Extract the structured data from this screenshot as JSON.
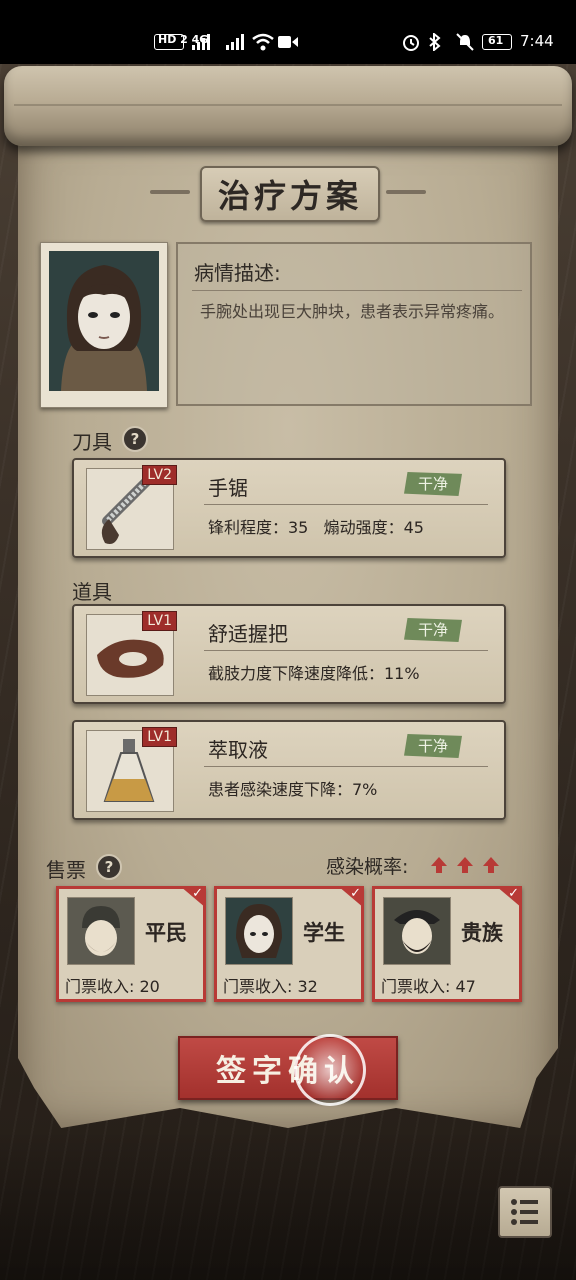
{
  "status_bar": {
    "left": "HD 2  4G",
    "time": "7:44",
    "battery": "61"
  },
  "title": "治疗方案",
  "patient": {
    "desc_title": "病情描述:",
    "desc_text": "手腕处出现巨大肿块，患者表示异常疼痛。"
  },
  "tools": {
    "label": "刀具",
    "help": "?",
    "item": {
      "name": "手锯",
      "level": "LV2",
      "state": "干净",
      "stat": "锋利程度：35   煽动强度：45"
    }
  },
  "props": {
    "label": "道具",
    "items": [
      {
        "name": "舒适握把",
        "level": "LV1",
        "state": "干净",
        "stat": "截肢力度下降速度降低：11%"
      },
      {
        "name": "萃取液",
        "level": "LV1",
        "state": "干净",
        "stat": "患者感染速度下降：7%"
      }
    ]
  },
  "tickets": {
    "label": "售票",
    "help": "?",
    "infection_label": "感染概率:",
    "items": [
      {
        "name": "平民",
        "income": "门票收入: 20"
      },
      {
        "name": "学生",
        "income": "门票收入: 32"
      },
      {
        "name": "贵族",
        "income": "门票收入: 47"
      }
    ]
  },
  "confirm_label": "签字确认",
  "colors": {
    "accent_red": "#b83a36",
    "clean_green": "#6f8a5a",
    "parchment": "#c8bda6"
  },
  "icons": [
    "hd-icon",
    "signal-icon",
    "wifi-icon",
    "video-icon",
    "alarm-icon",
    "bluetooth-icon",
    "mute-icon",
    "battery-icon",
    "help-icon",
    "up-arrow-icon",
    "check-icon",
    "menu-icon"
  ]
}
